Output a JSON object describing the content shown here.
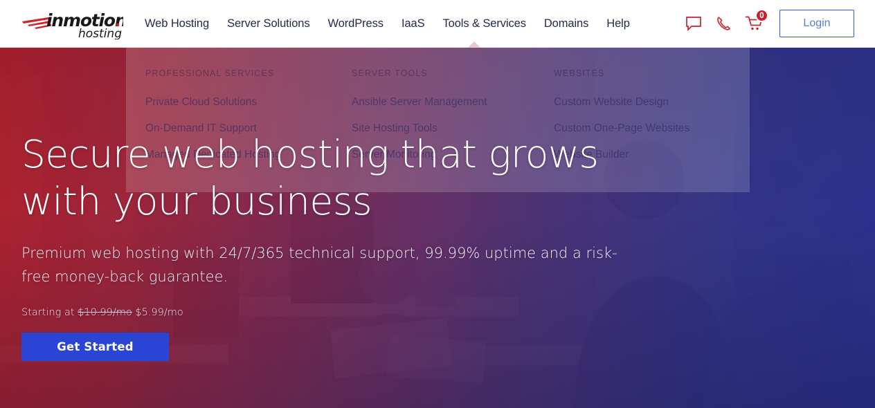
{
  "brand": {
    "name_bold": "inmotion",
    "name_sub": "hosting",
    "logo_red": "#d81f26",
    "logo_black": "#18171c"
  },
  "header": {
    "nav": [
      {
        "label": "Web Hosting"
      },
      {
        "label": "Server Solutions"
      },
      {
        "label": "WordPress"
      },
      {
        "label": "IaaS"
      },
      {
        "label": "Tools & Services"
      },
      {
        "label": "Domains"
      },
      {
        "label": "Help"
      }
    ],
    "icons": {
      "chat": "chat-icon",
      "phone": "phone-icon",
      "cart": "cart-icon"
    },
    "cart_count": "0",
    "login_label": "Login",
    "accent_red": "#cc2030",
    "accent_blue": "#2f55d4",
    "nav_text_color": "#232b4a"
  },
  "dropdown": {
    "columns": [
      {
        "heading": "PROFESSIONAL SERVICES",
        "links": [
          "Private Cloud Solutions",
          "On-Demand IT Support",
          "Managed Dedicated Hosting"
        ]
      },
      {
        "heading": "SERVER TOOLS",
        "links": [
          "Ansible Server Management",
          "Site Hosting Tools",
          "Server Monitoring"
        ]
      },
      {
        "heading": "WEBSITES",
        "links": [
          "Custom Website Design",
          "Custom One-Page Websites",
          "Website Builder"
        ]
      }
    ]
  },
  "hero": {
    "headline_line1": "Secure web hosting that grows",
    "headline_line2": "with your business",
    "subhead_line1": "Premium web hosting with 24/7/365 technical support, 99.99% uptime and a risk-",
    "subhead_line2": "free money-back guarantee.",
    "price_prefix": "Starting at",
    "price_old": "$10.99/mo",
    "price_new": "$5.99/mo",
    "cta_label": "Get Started",
    "cta_color": "#2a44d4",
    "gradient_from": "#b51622",
    "gradient_to": "#262e92"
  }
}
